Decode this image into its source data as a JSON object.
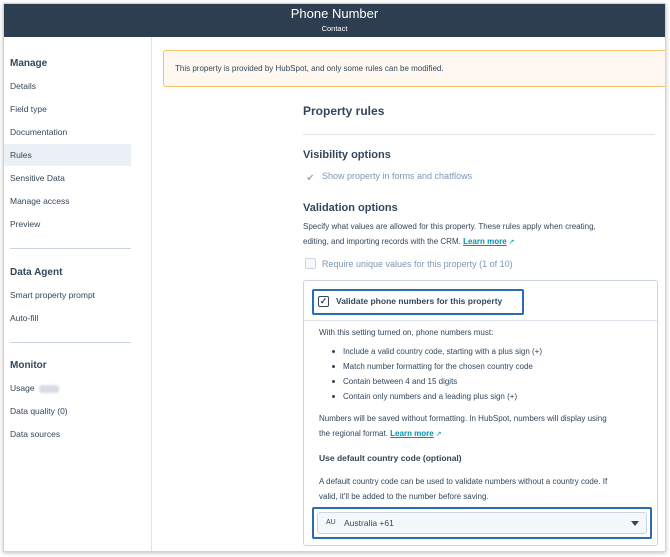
{
  "header": {
    "title": "Phone Number",
    "subtitle": "Contact"
  },
  "sidebar": {
    "manage": {
      "heading": "Manage",
      "items": [
        "Details",
        "Field type",
        "Documentation",
        "Rules",
        "Sensitive Data",
        "Manage access",
        "Preview"
      ],
      "active": "Rules"
    },
    "data_agent": {
      "heading": "Data Agent",
      "items": [
        "Smart property prompt",
        "Auto-fill"
      ]
    },
    "monitor": {
      "heading": "Monitor",
      "usage_label": "Usage",
      "data_quality_label": "Data quality (0)",
      "data_sources_label": "Data sources"
    }
  },
  "banner": {
    "text": "This property is provided by HubSpot, and only some rules can be modified."
  },
  "rules": {
    "title": "Property rules",
    "visibility": {
      "heading": "Visibility options",
      "show_in_forms": "Show property in forms and chatflows"
    },
    "validation": {
      "heading": "Validation options",
      "description_line1": "Specify what values are allowed for this property. These rules apply when creating,",
      "description_line2": "editing, and importing records with the CRM.",
      "learn_more": "Learn more",
      "unique_values": "Require unique values for this property (1 of 10)"
    },
    "phone_validation": {
      "checkbox_label": "Validate phone numbers for this property",
      "checked": true,
      "intro": "With this setting turned on, phone numbers must:",
      "requirements": [
        "Include a valid country code, starting with a plus sign (+)",
        "Match number formatting for the chosen country code",
        "Contain between 4 and 15 digits",
        "Contain only numbers and a leading plus sign (+)"
      ],
      "saved_line1": "Numbers will be saved without formatting. In HubSpot, numbers will display using",
      "saved_line2": "the regional format.",
      "learn_more": "Learn more",
      "default_code_heading": "Use default country code (optional)",
      "default_code_line1": "A default country code can be used to validate numbers without a country code. If",
      "default_code_line2": "valid, it'll be added to the number before saving.",
      "select": {
        "code": "AU",
        "value": "Australia +61"
      }
    }
  }
}
